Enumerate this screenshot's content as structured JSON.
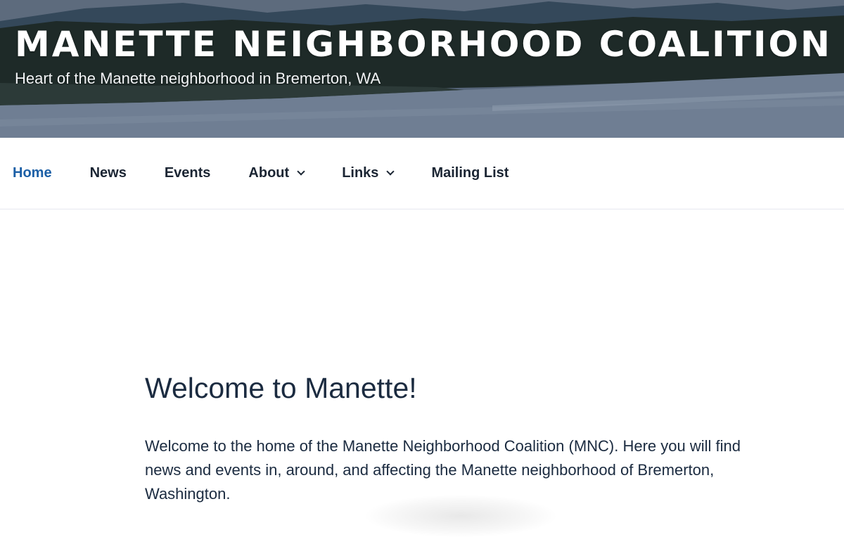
{
  "header": {
    "site_title": "MANETTE NEIGHBORHOOD COALITION",
    "tagline": "Heart of the Manette neighborhood in Bremerton, WA"
  },
  "nav": {
    "items": [
      {
        "label": "Home",
        "active": true,
        "has_dropdown": false
      },
      {
        "label": "News",
        "active": false,
        "has_dropdown": false
      },
      {
        "label": "Events",
        "active": false,
        "has_dropdown": false
      },
      {
        "label": "About",
        "active": false,
        "has_dropdown": true
      },
      {
        "label": "Links",
        "active": false,
        "has_dropdown": true
      },
      {
        "label": "Mailing List",
        "active": false,
        "has_dropdown": false
      }
    ]
  },
  "main": {
    "heading": "Welcome to Manette!",
    "intro": "Welcome to the home of the Manette Neighborhood Coalition (MNC).  Here you will find news and events in, around, and affecting the Manette neighborhood of Bremerton, Washington."
  },
  "colors": {
    "nav_active": "#1c5fa6",
    "nav_text": "#1b2533",
    "body_text": "#1b2b40"
  },
  "icons": {
    "dropdown": "chevron-down-icon"
  }
}
